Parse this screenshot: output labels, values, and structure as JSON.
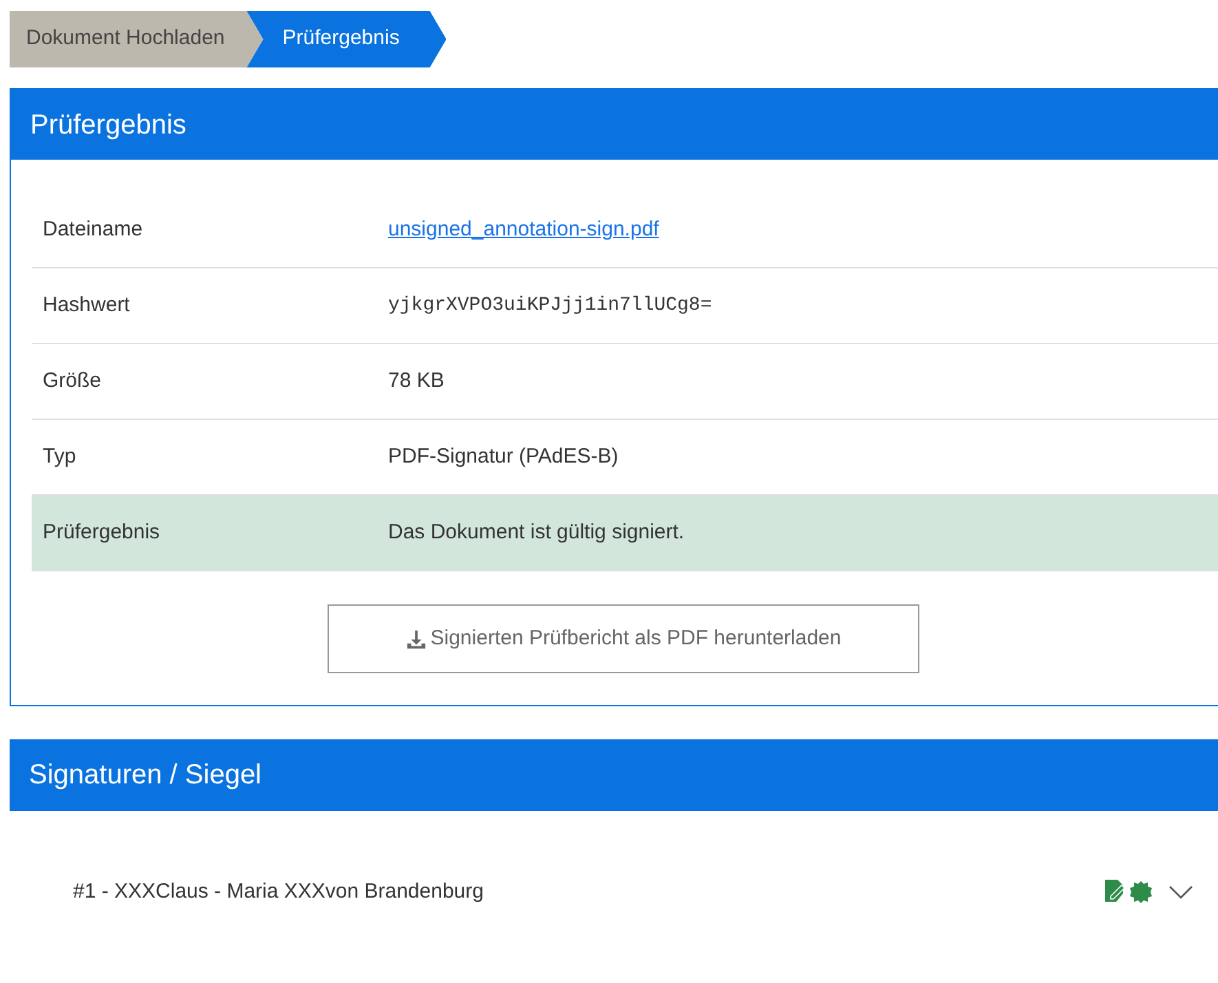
{
  "breadcrumb": [
    {
      "label": "Dokument Hochladen",
      "selected": false
    },
    {
      "label": "Prüfergebnis",
      "selected": true
    }
  ],
  "result_panel": {
    "title": "Prüfergebnis",
    "rows": [
      {
        "label": "Dateiname",
        "value": "unsigned_annotation-sign.pdf",
        "kind": "link"
      },
      {
        "label": "Hashwert",
        "value": "yjkgrXVPO3uiKPJjj1in7llUCg8=",
        "kind": "mono"
      },
      {
        "label": "Größe",
        "value": "78 KB",
        "kind": "text"
      },
      {
        "label": "Typ",
        "value": "PDF-Signatur (PAdES-B)",
        "kind": "text"
      },
      {
        "label": "Prüfergebnis",
        "value": "Das Dokument ist gültig signiert.",
        "kind": "result"
      }
    ],
    "download_button": "Signierten Prüfbericht als PDF herunterladen"
  },
  "signatures_panel": {
    "title": "Signaturen / Siegel",
    "items": [
      {
        "label": "#1 - XXXClaus - Maria XXXvon Brandenburg",
        "expanded": false
      }
    ]
  }
}
